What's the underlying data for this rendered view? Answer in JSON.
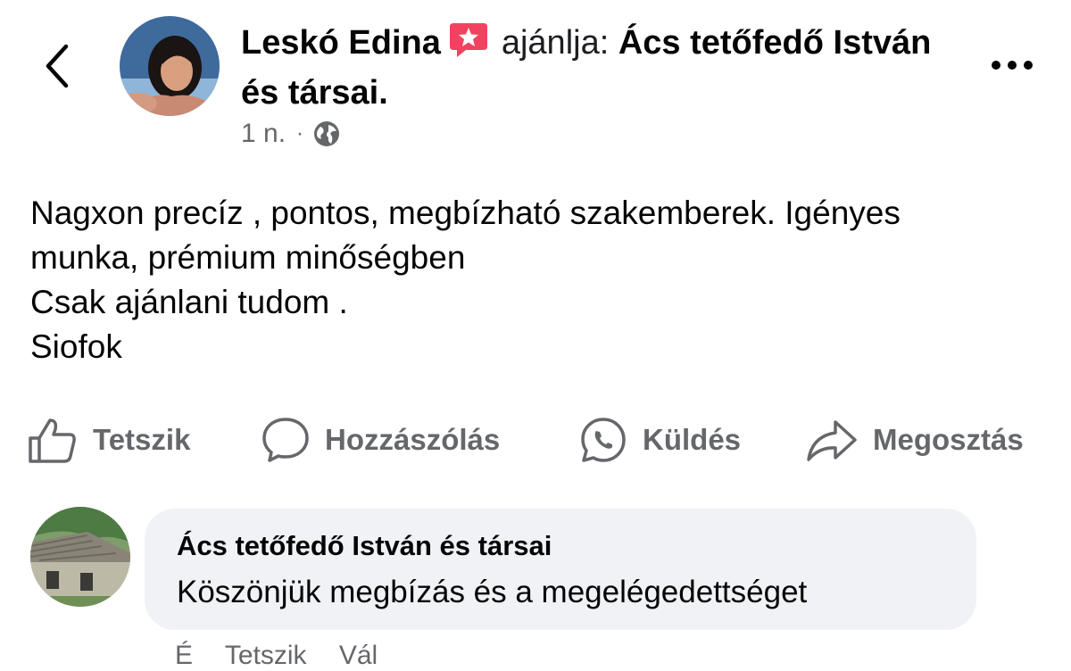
{
  "header": {
    "author": "Leskó Edina",
    "verb": "ajánlja:",
    "page_name": "Ács tetőfedő István és társai.",
    "time": "1 n.",
    "separator": "·",
    "audience_icon": "globe-icon",
    "back_icon": "chevron-left-icon",
    "more_icon": "more-dots-icon",
    "recommend_icon": "recommend-badge-icon"
  },
  "post": {
    "lines": [
      "Nagxon precíz , pontos, megbízható szakemberek. Igényes",
      "munka, prémium minőségben",
      "Csak ajánlani tudom .",
      "Siofok"
    ]
  },
  "actions": {
    "like": "Tetszik",
    "comment": "Hozzászólás",
    "send": "Küldés",
    "share": "Megosztás"
  },
  "comment": {
    "author": "Ács tetőfedő István és társai",
    "text": "Köszönjük megbízás és a megelégedettséget",
    "footer": [
      "É",
      "Tetszik",
      "Vál"
    ]
  },
  "colors": {
    "secondary_text": "#65676b",
    "bubble_bg": "#f0f2f5",
    "recommend_red": "#f3425f"
  }
}
